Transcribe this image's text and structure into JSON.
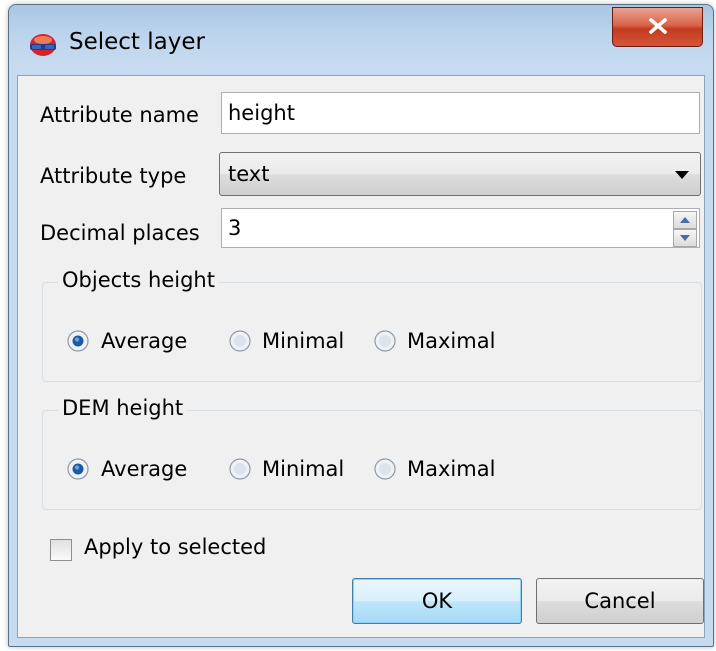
{
  "window": {
    "title": "Select layer",
    "close_icon": "close-icon"
  },
  "form": {
    "attribute_name_label": "Attribute name",
    "attribute_name_value": "height",
    "attribute_type_label": "Attribute type",
    "attribute_type_value": "text",
    "decimal_places_label": "Decimal places",
    "decimal_places_value": "3"
  },
  "objects_height": {
    "title": "Objects height",
    "options": [
      "Average",
      "Minimal",
      "Maximal"
    ],
    "selected": "Average"
  },
  "dem_height": {
    "title": "DEM height",
    "options": [
      "Average",
      "Minimal",
      "Maximal"
    ],
    "selected": "Average"
  },
  "apply_to_selected": {
    "label": "Apply to selected",
    "checked": false
  },
  "buttons": {
    "ok": "OK",
    "cancel": "Cancel"
  }
}
